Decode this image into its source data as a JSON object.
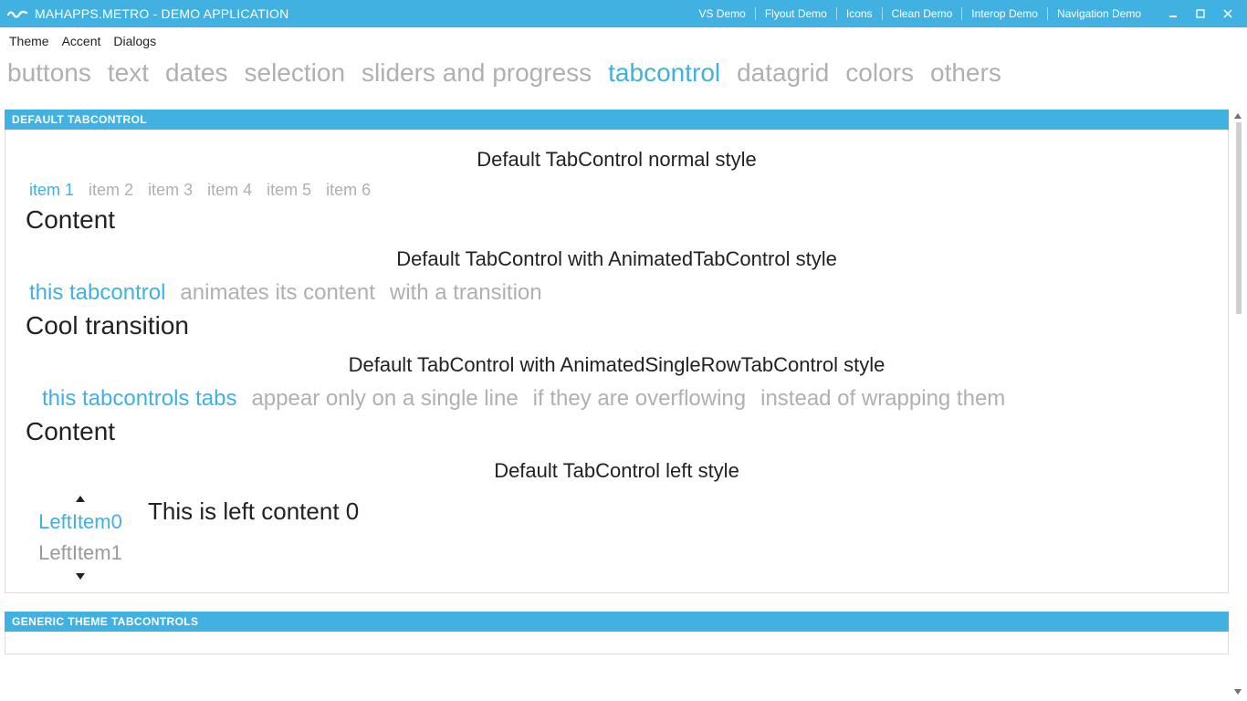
{
  "titlebar": {
    "title": "MAHAPPS.METRO - DEMO APPLICATION",
    "links": [
      "VS Demo",
      "Flyout Demo",
      "Icons",
      "Clean Demo",
      "Interop Demo",
      "Navigation Demo"
    ]
  },
  "menubar": [
    "Theme",
    "Accent",
    "Dialogs"
  ],
  "maintabs": [
    "buttons",
    "text",
    "dates",
    "selection",
    "sliders and progress",
    "tabcontrol",
    "datagrid",
    "colors",
    "others"
  ],
  "maintabs_active_index": 5,
  "group1": {
    "header": "DEFAULT TABCONTROL",
    "section1": {
      "title": "Default TabControl normal style",
      "tabs": [
        "item 1",
        "item 2",
        "item 3",
        "item 4",
        "item 5",
        "item 6"
      ],
      "active_index": 0,
      "content": "Content"
    },
    "section2": {
      "title": "Default TabControl with AnimatedTabControl style",
      "tabs": [
        "this tabcontrol",
        "animates its content",
        "with a transition"
      ],
      "active_index": 0,
      "content": "Cool transition"
    },
    "section3": {
      "title": "Default TabControl with AnimatedSingleRowTabControl style",
      "tabs": [
        "this tabcontrols tabs",
        "appear only on a single line",
        "if they are overflowing",
        "instead of wrapping them"
      ],
      "active_index": 0,
      "content": "Content"
    },
    "section4": {
      "title": "Default TabControl left style",
      "left_tabs": [
        "LeftItem0",
        "LeftItem1"
      ],
      "left_active_index": 0,
      "content": "This is left content 0"
    }
  },
  "group2": {
    "header": "GENERIC THEME TABCONTROLS"
  }
}
